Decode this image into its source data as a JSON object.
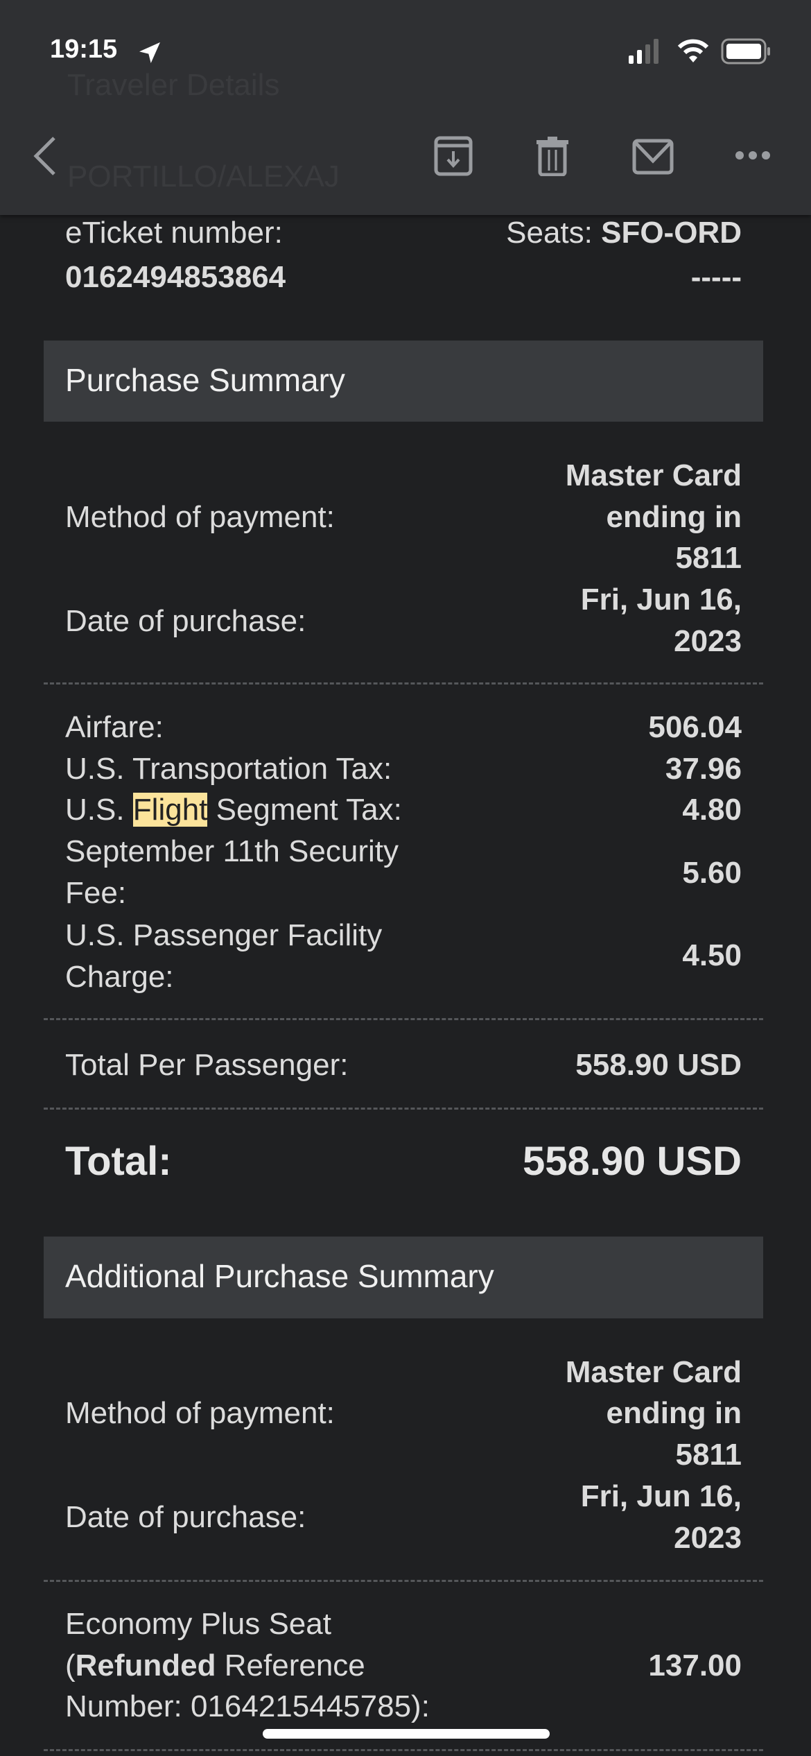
{
  "status_bar": {
    "time": "19:15"
  },
  "header": {
    "ghost_title": "Traveler Details",
    "ghost_name": "PORTILLO/ALEXAJ",
    "icons": [
      "back-chevron-icon",
      "archive-icon",
      "trash-icon",
      "mail-icon",
      "more-icon"
    ]
  },
  "ticket": {
    "eticket_label": "eTicket number:",
    "eticket_value": "0162494853864",
    "seats_label": "Seats:",
    "seats_route": "SFO-ORD",
    "seats_value": "-----"
  },
  "purchase_summary": {
    "title": "Purchase Summary",
    "method_label": "Method of payment:",
    "method_lines": [
      "Master Card",
      "ending in",
      "5811"
    ],
    "date_label": "Date of purchase:",
    "date_lines": [
      "Fri, Jun 16,",
      "2023"
    ],
    "airfare_label": "Airfare:",
    "airfare_value": "506.04",
    "transport_tax_label": "U.S. Transportation Tax:",
    "transport_tax_value": "37.96",
    "segment_tax_pre": "U.S. ",
    "segment_tax_highlight": "Flight",
    "segment_tax_post": " Segment Tax:",
    "segment_tax_value": "4.80",
    "security_fee_lines": [
      "September 11th Security",
      "Fee:"
    ],
    "security_fee_value": "5.60",
    "facility_lines": [
      "U.S. Passenger Facility",
      "Charge:"
    ],
    "facility_value": "4.50",
    "per_passenger_label": "Total Per Passenger:",
    "per_passenger_value": "558.90 USD",
    "total_label": "Total:",
    "total_value": "558.90 USD"
  },
  "additional_summary": {
    "title": "Additional Purchase Summary",
    "method_label": "Method of payment:",
    "method_lines": [
      "Master Card",
      "ending in",
      "5811"
    ],
    "date_label": "Date of purchase:",
    "date_lines": [
      "Fri, Jun 16,",
      "2023"
    ],
    "item_line1": "Economy Plus Seat",
    "item_paren": "(",
    "item_bold": "Refunded",
    "item_line2_rest": " Reference",
    "item_line3": "Number: 0164215445785):",
    "item_value": "137.00"
  },
  "colors": {
    "header_bg": "#2f3033",
    "body_bg": "#1f2022",
    "section_bg": "#393b3e",
    "highlight": "#fbe39b"
  }
}
